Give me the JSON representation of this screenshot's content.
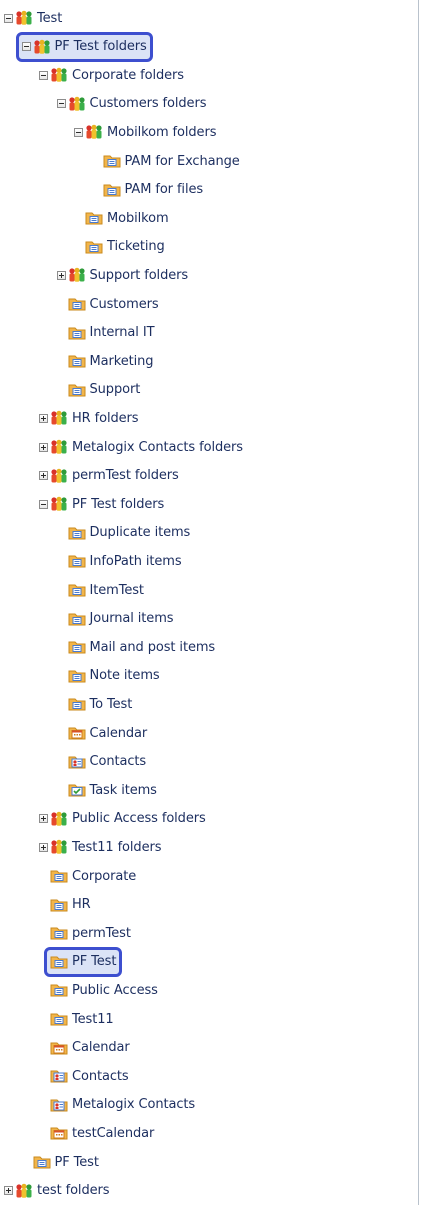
{
  "tree": {
    "rows": [
      {
        "label": "Test",
        "depth": 0,
        "icon": "people-group-icon",
        "expander": "minus"
      },
      {
        "label": "PF Test folders",
        "depth": 1,
        "icon": "people-group-icon",
        "expander": "minus",
        "highlighted": true
      },
      {
        "label": "Corporate folders",
        "depth": 2,
        "icon": "people-group-icon",
        "expander": "minus"
      },
      {
        "label": "Customers folders",
        "depth": 3,
        "icon": "people-group-icon",
        "expander": "minus"
      },
      {
        "label": "Mobilkom folders",
        "depth": 4,
        "icon": "people-group-icon",
        "expander": "minus"
      },
      {
        "label": "PAM for Exchange",
        "depth": 5,
        "icon": "public-folder-icon"
      },
      {
        "label": "PAM for files",
        "depth": 5,
        "icon": "public-folder-icon"
      },
      {
        "label": "Mobilkom",
        "depth": 4,
        "icon": "public-folder-icon"
      },
      {
        "label": "Ticketing",
        "depth": 4,
        "icon": "public-folder-icon"
      },
      {
        "label": "Support folders",
        "depth": 3,
        "icon": "people-group-icon",
        "expander": "plus"
      },
      {
        "label": "Customers",
        "depth": 3,
        "icon": "public-folder-icon"
      },
      {
        "label": "Internal IT",
        "depth": 3,
        "icon": "public-folder-icon"
      },
      {
        "label": "Marketing",
        "depth": 3,
        "icon": "public-folder-icon"
      },
      {
        "label": "Support",
        "depth": 3,
        "icon": "public-folder-icon"
      },
      {
        "label": "HR folders",
        "depth": 2,
        "icon": "people-group-icon",
        "expander": "plus"
      },
      {
        "label": "Metalogix Contacts folders",
        "depth": 2,
        "icon": "people-group-icon",
        "expander": "plus"
      },
      {
        "label": "permTest folders",
        "depth": 2,
        "icon": "people-group-icon",
        "expander": "plus"
      },
      {
        "label": "PF Test folders",
        "depth": 2,
        "icon": "people-group-icon",
        "expander": "minus"
      },
      {
        "label": "Duplicate items",
        "depth": 3,
        "icon": "public-folder-icon"
      },
      {
        "label": "InfoPath items",
        "depth": 3,
        "icon": "public-folder-icon"
      },
      {
        "label": "ItemTest",
        "depth": 3,
        "icon": "public-folder-icon"
      },
      {
        "label": "Journal items",
        "depth": 3,
        "icon": "public-folder-icon"
      },
      {
        "label": "Mail and post items",
        "depth": 3,
        "icon": "public-folder-icon"
      },
      {
        "label": "Note items",
        "depth": 3,
        "icon": "public-folder-icon"
      },
      {
        "label": "To Test",
        "depth": 3,
        "icon": "public-folder-icon"
      },
      {
        "label": "Calendar",
        "depth": 3,
        "icon": "calendar-folder-icon"
      },
      {
        "label": "Contacts",
        "depth": 3,
        "icon": "contacts-folder-icon"
      },
      {
        "label": "Task items",
        "depth": 3,
        "icon": "task-folder-icon"
      },
      {
        "label": "Public Access folders",
        "depth": 2,
        "icon": "people-group-icon",
        "expander": "plus"
      },
      {
        "label": "Test11 folders",
        "depth": 2,
        "icon": "people-group-icon",
        "expander": "plus"
      },
      {
        "label": "Corporate",
        "depth": 2,
        "icon": "public-folder-icon"
      },
      {
        "label": "HR",
        "depth": 2,
        "icon": "public-folder-icon"
      },
      {
        "label": "permTest",
        "depth": 2,
        "icon": "public-folder-icon"
      },
      {
        "label": "PF Test",
        "depth": 2,
        "icon": "public-folder-icon",
        "highlighted": true
      },
      {
        "label": "Public Access",
        "depth": 2,
        "icon": "public-folder-icon"
      },
      {
        "label": "Test11",
        "depth": 2,
        "icon": "public-folder-icon"
      },
      {
        "label": "Calendar",
        "depth": 2,
        "icon": "calendar-folder-icon"
      },
      {
        "label": "Contacts",
        "depth": 2,
        "icon": "contacts-folder-icon"
      },
      {
        "label": "Metalogix Contacts",
        "depth": 2,
        "icon": "contacts-folder-icon"
      },
      {
        "label": "testCalendar",
        "depth": 2,
        "icon": "calendar-folder-icon"
      },
      {
        "label": "PF Test",
        "depth": 1,
        "icon": "public-folder-icon"
      },
      {
        "label": "test folders",
        "depth": 0,
        "icon": "people-group-icon",
        "expander": "plus"
      }
    ]
  },
  "colors": {
    "highlight_border": "#3d4fcf",
    "highlight_fill": "#dbe3f6",
    "text": "#1c2e5f",
    "folder": "#f2b54a"
  }
}
